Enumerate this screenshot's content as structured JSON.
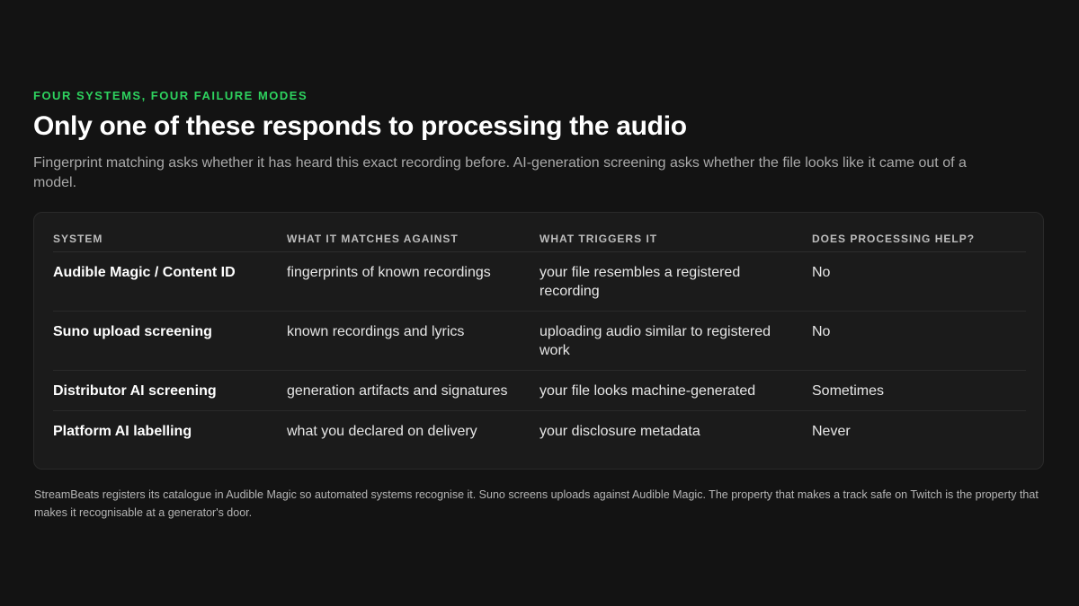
{
  "eyebrow": "FOUR SYSTEMS, FOUR FAILURE MODES",
  "title": "Only one of these responds to processing the audio",
  "subtitle": "Fingerprint matching asks whether it has heard this exact recording before. AI-generation screening asks whether the file looks like it came out of a model.",
  "table": {
    "headers": [
      "SYSTEM",
      "WHAT IT MATCHES AGAINST",
      "WHAT TRIGGERS IT",
      "DOES PROCESSING HELP?"
    ],
    "rows": [
      [
        "Audible Magic / Content ID",
        "fingerprints of known recordings",
        "your file resembles a registered recording",
        "No"
      ],
      [
        "Suno upload screening",
        "known recordings and lyrics",
        "uploading audio similar to registered work",
        "No"
      ],
      [
        "Distributor AI screening",
        "generation artifacts and signatures",
        "your file looks machine-generated",
        "Sometimes"
      ],
      [
        "Platform AI labelling",
        "what you declared on delivery",
        "your disclosure metadata",
        "Never"
      ]
    ]
  },
  "footnote": "StreamBeats registers its catalogue in Audible Magic so automated systems recognise it. Suno screens uploads against Audible Magic. The property that makes a track safe on Twitch is the property that makes it recognisable at a generator's door.",
  "colors": {
    "background": "#131313",
    "card": "#1b1b1b",
    "accent": "#2ed35f"
  }
}
